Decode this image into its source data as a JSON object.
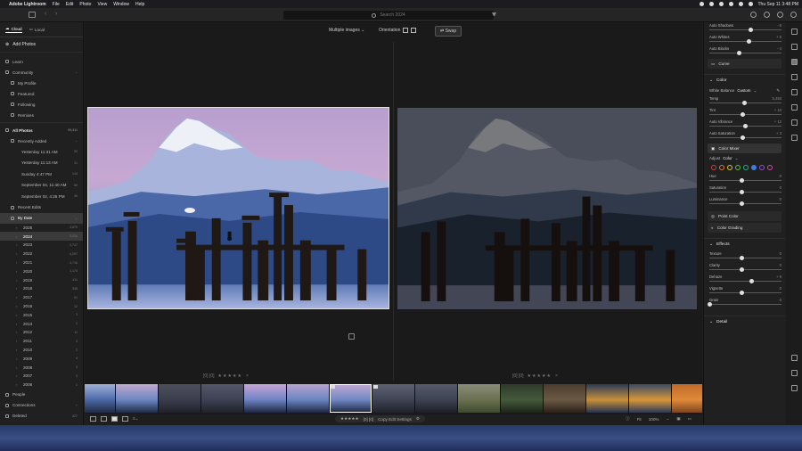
{
  "menubar": {
    "app": "Adobe Lightroom",
    "items": [
      "File",
      "Edit",
      "Photo",
      "View",
      "Window",
      "Help"
    ],
    "clock": "Thu Sep 11  3:48 PM"
  },
  "toolbar": {
    "search_placeholder": "Search 2024"
  },
  "sidebar": {
    "tab_cloud": "Cloud",
    "tab_local": "Local",
    "add_photos": "Add Photos",
    "learn": "Learn",
    "community": "Community",
    "my_profile": "My Profile",
    "featured": "Featured",
    "following": "Following",
    "remixes": "Remixes",
    "all_photos": "All Photos",
    "all_photos_count": "99,311",
    "recently_added": "Recently Added",
    "recent": [
      {
        "label": "Yesterday 11:31 AM",
        "count": "90"
      },
      {
        "label": "Yesterday 11:13 AM",
        "count": "31"
      },
      {
        "label": "Sunday 4:47 PM",
        "count": "144"
      },
      {
        "label": "September 04, 11:40 AM",
        "count": "89"
      },
      {
        "label": "September 02, 4:26 PM",
        "count": "46"
      }
    ],
    "recent_edits": "Recent Edits",
    "by_date": "By Date",
    "years": [
      {
        "label": "2025",
        "count": "4,675"
      },
      {
        "label": "2024",
        "count": "3,034"
      },
      {
        "label": "2023",
        "count": "3,747"
      },
      {
        "label": "2022",
        "count": "4,297"
      },
      {
        "label": "2021",
        "count": "4,716"
      },
      {
        "label": "2020",
        "count": "3,174"
      },
      {
        "label": "2019",
        "count": "411"
      },
      {
        "label": "2018",
        "count": "345"
      },
      {
        "label": "2017",
        "count": "91"
      },
      {
        "label": "2016",
        "count": "12"
      },
      {
        "label": "2015",
        "count": "3"
      },
      {
        "label": "2013",
        "count": "2"
      },
      {
        "label": "2012",
        "count": "11"
      },
      {
        "label": "2011",
        "count": "3"
      },
      {
        "label": "2010",
        "count": "2"
      },
      {
        "label": "2009",
        "count": "4"
      },
      {
        "label": "2008",
        "count": "3"
      },
      {
        "label": "2007",
        "count": "3"
      },
      {
        "label": "2006",
        "count": "1"
      }
    ],
    "people": "People",
    "connections": "Connections",
    "deleted": "Deleted",
    "deleted_count": "427"
  },
  "view": {
    "mode_label": "Multiple images",
    "orientation_label": "Orientation",
    "swap_label": "Swap"
  },
  "photos": {
    "left_rating": "★★★★★",
    "right_rating": "★★★★★",
    "left_flag": "[0] [0]",
    "right_flag": "[0] [0]",
    "x_mark": "×"
  },
  "bottombar": {
    "stars": "★★★★★",
    "copy_edit": "Copy Edit Settings",
    "fit": "Fit",
    "zoom": "100%",
    "count_label": "[0] [0]"
  },
  "edit_panel": {
    "top_sliders": [
      {
        "label": "Auto Shadows",
        "value": "- 6",
        "pos": 0.64
      },
      {
        "label": "Auto Whites",
        "value": "+ 8",
        "pos": 0.62
      },
      {
        "label": "Auto Blacks",
        "value": "- 4",
        "pos": 0.47
      }
    ],
    "curve": "Curve",
    "color": "Color",
    "white_balance_label": "White Balance",
    "white_balance_value": "Custom",
    "color_sliders": [
      {
        "label": "Temp",
        "value": "5,450",
        "pos": 0.55
      },
      {
        "label": "Tint",
        "value": "+ 10",
        "pos": 0.52
      },
      {
        "label": "Auto Vibrance",
        "value": "+ 12",
        "pos": 0.56
      },
      {
        "label": "Auto Saturation",
        "value": "+ 3",
        "pos": 0.52
      }
    ],
    "color_mixer": "Color Mixer",
    "adjust_label": "Adjust",
    "adjust_value": "Color",
    "mixer_sliders": [
      {
        "label": "Hue",
        "value": "0",
        "pos": 0.5
      },
      {
        "label": "Saturation",
        "value": "0",
        "pos": 0.5
      },
      {
        "label": "Luminance",
        "value": "0",
        "pos": 0.5
      }
    ],
    "point_color": "Point Color",
    "color_grading": "Color Grading",
    "effects": "Effects",
    "effects_sliders": [
      {
        "label": "Texture",
        "value": "0",
        "pos": 0.5
      },
      {
        "label": "Clarity",
        "value": "0",
        "pos": 0.5
      },
      {
        "label": "Dehaze",
        "value": "+ 9",
        "pos": 0.66
      },
      {
        "label": "Vignette",
        "value": "0",
        "pos": 0.5
      },
      {
        "label": "Grain",
        "value": "0",
        "pos": 0.0
      }
    ],
    "detail": "Detail",
    "swatch_colors": [
      "#d03a3a",
      "#e07a2c",
      "#d8c632",
      "#5fbf3e",
      "#2faa8e",
      "#3e7ce0",
      "#9a4bd8",
      "#d04aa8"
    ]
  }
}
